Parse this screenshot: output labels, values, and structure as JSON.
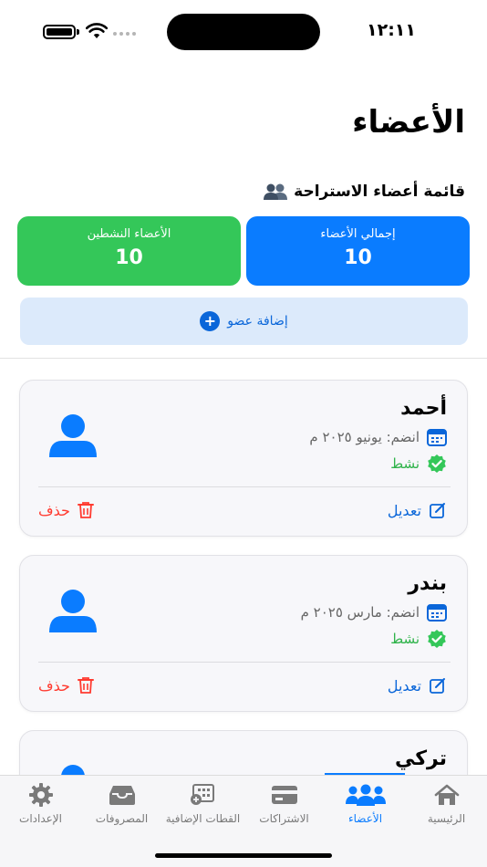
{
  "status_bar": {
    "time": "١٢:١١"
  },
  "page": {
    "title": "الأعضاء"
  },
  "section": {
    "title": "قائمة أعضاء الاستراحة"
  },
  "stats": {
    "total": {
      "label": "إجمالي الأعضاء",
      "value": "10"
    },
    "active": {
      "label": "الأعضاء النشطين",
      "value": "10"
    }
  },
  "add_member": {
    "label": "إضافة عضو"
  },
  "members": [
    {
      "name": "أحمد",
      "joined": "انضم: يونيو ٢٠٢٥ م",
      "status": "نشط",
      "edit": "تعديل",
      "delete": "حذف"
    },
    {
      "name": "بندر",
      "joined": "انضم: مارس ٢٠٢٥ م",
      "status": "نشط",
      "edit": "تعديل",
      "delete": "حذف"
    },
    {
      "name": "تركي"
    }
  ],
  "tabs": [
    {
      "label": "الرئيسية",
      "icon": "home-icon",
      "active": false
    },
    {
      "label": "الأعضاء",
      "icon": "people-icon",
      "active": true
    },
    {
      "label": "الاشتراكات",
      "icon": "card-icon",
      "active": false
    },
    {
      "label": "القطات الإضافية",
      "icon": "calculator-icon",
      "active": false
    },
    {
      "label": "المصروفات",
      "icon": "tray-icon",
      "active": false
    },
    {
      "label": "الإعدادات",
      "icon": "gear-icon",
      "active": false
    }
  ],
  "colors": {
    "accent": "#0a7cff",
    "success": "#34c759",
    "danger": "#ff3b30"
  }
}
